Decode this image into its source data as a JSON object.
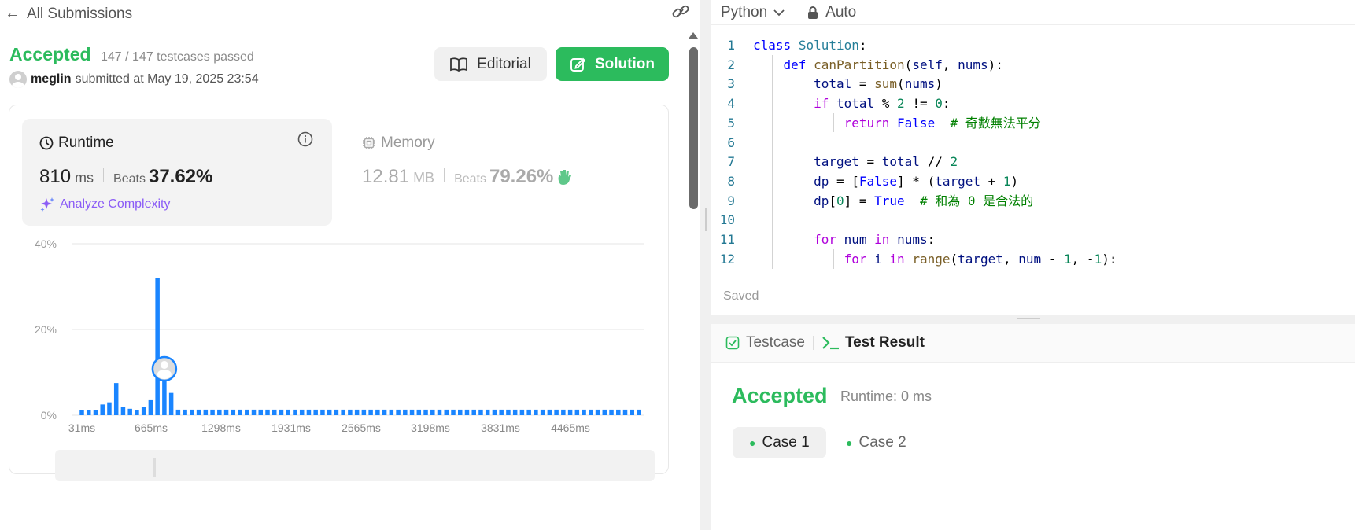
{
  "header": {
    "back_icon": "arrow-left-icon",
    "title": "All Submissions",
    "link_icon": "link-icon"
  },
  "submission": {
    "status": "Accepted",
    "testcases": "147 / 147 testcases passed",
    "user": "meglin",
    "submitted_text": "submitted at May 19, 2025 23:54"
  },
  "buttons": {
    "editorial": "Editorial",
    "solution": "Solution"
  },
  "runtime": {
    "label": "Runtime",
    "value": "810",
    "unit": "ms",
    "beats_label": "Beats",
    "beats": "37.62%",
    "analyze": "Analyze Complexity"
  },
  "memory": {
    "label": "Memory",
    "value": "12.81",
    "unit": "MB",
    "beats_label": "Beats",
    "beats": "79.26%"
  },
  "chart_data": {
    "type": "bar",
    "y_ticks": [
      "40%",
      "20%",
      "0%"
    ],
    "ylim": [
      0,
      40
    ],
    "x_tick_labels": [
      "31ms",
      "665ms",
      "1298ms",
      "1931ms",
      "2565ms",
      "3198ms",
      "3831ms",
      "4465ms"
    ],
    "values": [
      1.2,
      1.2,
      1.2,
      2.5,
      3,
      7.5,
      2,
      1.5,
      1.2,
      2,
      3.5,
      32,
      10.5,
      5.2,
      1.3,
      1.3,
      1.3,
      1.3,
      1.3,
      1.3,
      1.3,
      1.3,
      1.3,
      1.3,
      1.3,
      1.3,
      1.3,
      1.3,
      1.3,
      1.3,
      1.3,
      1.3,
      1.3,
      1.3,
      1.3,
      1.3,
      1.3,
      1.3,
      1.3,
      1.3,
      1.3,
      1.3,
      1.3,
      1.3,
      1.3,
      1.3,
      1.3,
      1.3,
      1.3,
      1.3,
      1.3,
      1.3,
      1.3,
      1.3,
      1.3,
      1.3,
      1.3,
      1.3,
      1.3,
      1.3,
      1.3,
      1.3,
      1.3,
      1.3,
      1.3,
      1.3,
      1.3,
      1.3,
      1.3,
      1.3,
      1.3,
      1.3,
      1.3,
      1.3,
      1.3,
      1.3,
      1.3,
      1.3,
      1.3,
      1.3,
      1.3,
      1.3
    ],
    "highlight_index": 12,
    "bar_color": "#1a85ff"
  },
  "editor": {
    "language": "Python",
    "mode": "Auto",
    "saved": "Saved",
    "lines": [
      {
        "n": "1",
        "code": "class Solution:"
      },
      {
        "n": "2",
        "code": "    def canPartition(self, nums):"
      },
      {
        "n": "3",
        "code": "        total = sum(nums)"
      },
      {
        "n": "4",
        "code": "        if total % 2 != 0:"
      },
      {
        "n": "5",
        "code": "            return False  # 奇數無法平分"
      },
      {
        "n": "6",
        "code": ""
      },
      {
        "n": "7",
        "code": "        target = total // 2"
      },
      {
        "n": "8",
        "code": "        dp = [False] * (target + 1)"
      },
      {
        "n": "9",
        "code": "        dp[0] = True  # 和為 0 是合法的"
      },
      {
        "n": "10",
        "code": ""
      },
      {
        "n": "11",
        "code": "        for num in nums:"
      },
      {
        "n": "12",
        "code": "            for i in range(target, num - 1, -1):"
      }
    ]
  },
  "result": {
    "tab_testcase": "Testcase",
    "tab_result": "Test Result",
    "status": "Accepted",
    "runtime": "Runtime: 0 ms",
    "cases": [
      "Case 1",
      "Case 2"
    ]
  },
  "colors": {
    "accent_green": "#2cbb5d",
    "bar_blue": "#1a85ff",
    "analyze_purple": "#8b5cf6"
  }
}
